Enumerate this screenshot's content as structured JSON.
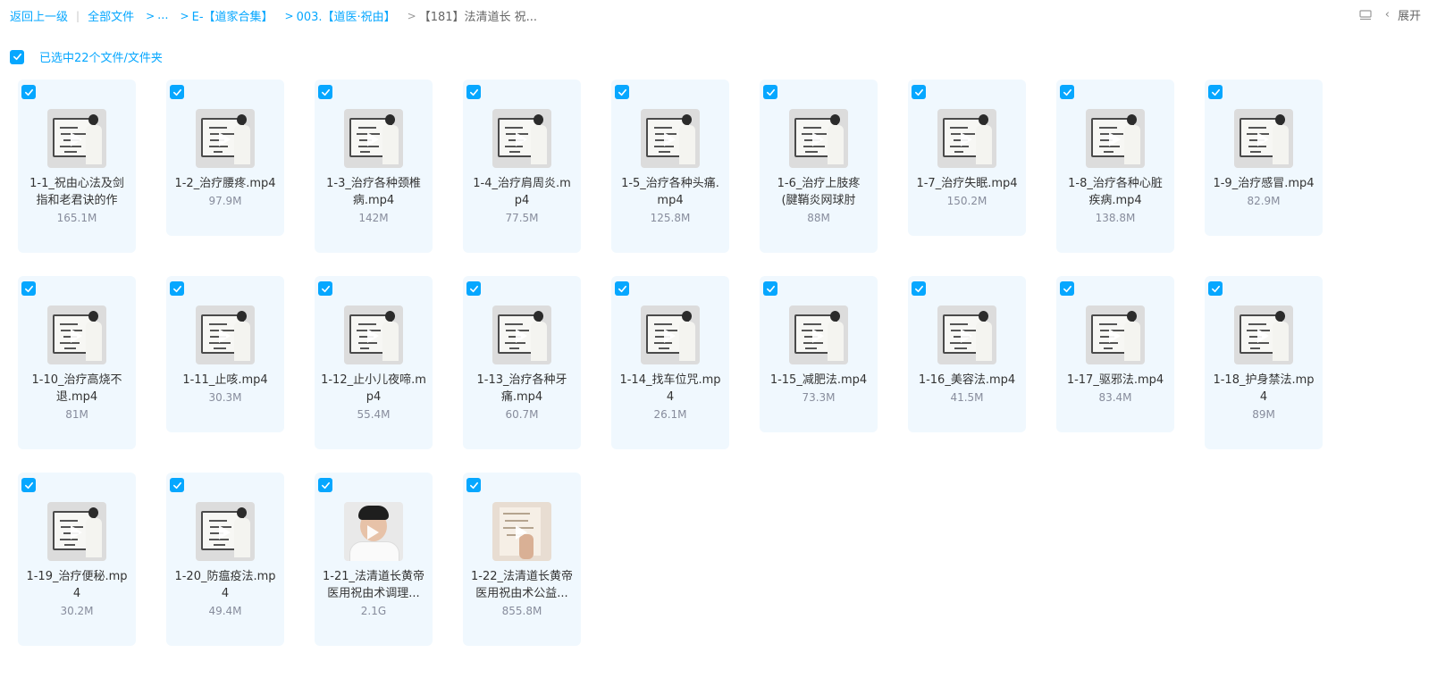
{
  "breadcrumb": {
    "back": "返回上一级",
    "all_files": "全部文件",
    "ellipsis": "...",
    "level1": "E-【道家合集】",
    "level2": "003.【道医·祝由】",
    "current": "【181】法清道长 祝..."
  },
  "toolbar": {
    "expand_label": "展开",
    "layout_icon": "list-view-icon",
    "expand_icon": "chevron-left-icon"
  },
  "selection": {
    "label": "已选中22个文件/文件夹",
    "checked": true
  },
  "colors": {
    "accent": "#06a7ff",
    "card_bg": "#f0f8fe",
    "size_text": "#878c9c"
  },
  "files": [
    {
      "name_lines": [
        "1-1_祝由心法及剑",
        "指和老君诀的作"
      ],
      "size": "165.1M",
      "thumb": "board"
    },
    {
      "name_lines": [
        "1-2_治疗腰疼.mp4"
      ],
      "size": "97.9M",
      "thumb": "board"
    },
    {
      "name_lines": [
        "1-3_治疗各种颈椎",
        "病.mp4"
      ],
      "size": "142M",
      "thumb": "board"
    },
    {
      "name_lines": [
        "1-4_治疗肩周炎.m",
        "p4"
      ],
      "size": "77.5M",
      "thumb": "board"
    },
    {
      "name_lines": [
        "1-5_治疗各种头痛.",
        "mp4"
      ],
      "size": "125.8M",
      "thumb": "board"
    },
    {
      "name_lines": [
        "1-6_治疗上肢疼",
        "(腱鞘炎网球肘"
      ],
      "size": "88M",
      "thumb": "board"
    },
    {
      "name_lines": [
        "1-7_治疗失眠.mp4"
      ],
      "size": "150.2M",
      "thumb": "board"
    },
    {
      "name_lines": [
        "1-8_治疗各种心脏",
        "疾病.mp4"
      ],
      "size": "138.8M",
      "thumb": "board"
    },
    {
      "name_lines": [
        "1-9_治疗感冒.mp4"
      ],
      "size": "82.9M",
      "thumb": "board"
    },
    {
      "name_lines": [
        "1-10_治疗高烧不",
        "退.mp4"
      ],
      "size": "81M",
      "thumb": "board"
    },
    {
      "name_lines": [
        "1-11_止咳.mp4"
      ],
      "size": "30.3M",
      "thumb": "board"
    },
    {
      "name_lines": [
        "1-12_止小儿夜啼.m",
        "p4"
      ],
      "size": "55.4M",
      "thumb": "board"
    },
    {
      "name_lines": [
        "1-13_治疗各种牙",
        "痛.mp4"
      ],
      "size": "60.7M",
      "thumb": "board"
    },
    {
      "name_lines": [
        "1-14_找车位咒.mp",
        "4"
      ],
      "size": "26.1M",
      "thumb": "board"
    },
    {
      "name_lines": [
        "1-15_减肥法.mp4"
      ],
      "size": "73.3M",
      "thumb": "board"
    },
    {
      "name_lines": [
        "1-16_美容法.mp4"
      ],
      "size": "41.5M",
      "thumb": "board"
    },
    {
      "name_lines": [
        "1-17_驱邪法.mp4"
      ],
      "size": "83.4M",
      "thumb": "board"
    },
    {
      "name_lines": [
        "1-18_护身禁法.mp",
        "4"
      ],
      "size": "89M",
      "thumb": "board"
    },
    {
      "name_lines": [
        "1-19_治疗便秘.mp",
        "4"
      ],
      "size": "30.2M",
      "thumb": "board"
    },
    {
      "name_lines": [
        "1-20_防瘟疫法.mp",
        "4"
      ],
      "size": "49.4M",
      "thumb": "board"
    },
    {
      "name_lines": [
        "1-21_法清道长黄帝",
        "医用祝由术调理..."
      ],
      "size": "2.1G",
      "thumb": "portrait"
    },
    {
      "name_lines": [
        "1-22_法清道长黄帝",
        "医用祝由术公益..."
      ],
      "size": "855.8M",
      "thumb": "warm"
    }
  ]
}
